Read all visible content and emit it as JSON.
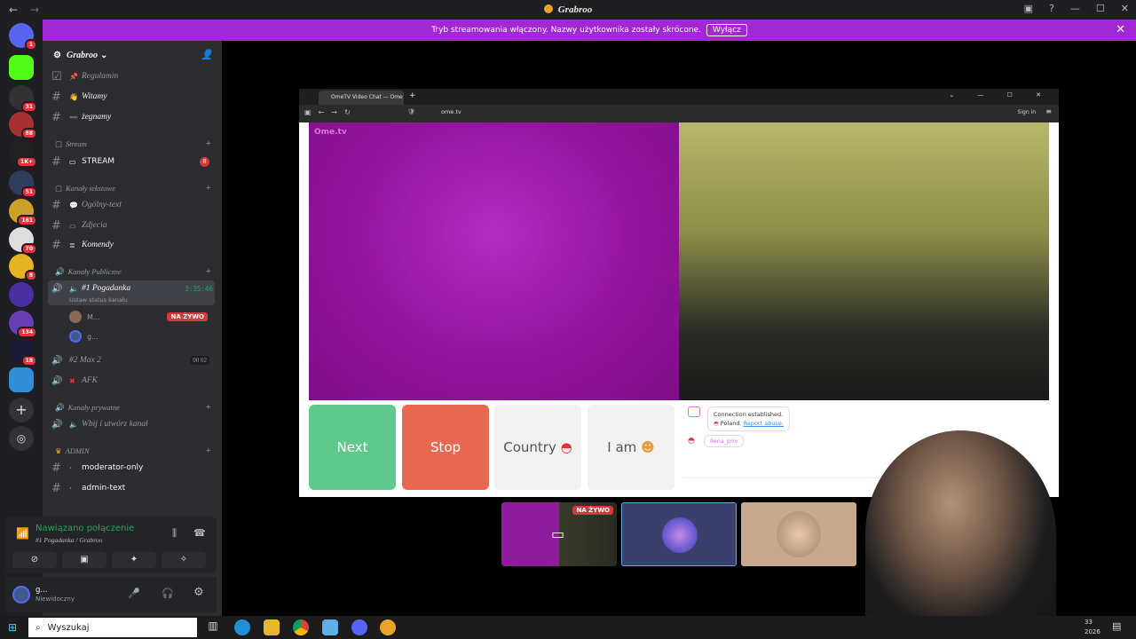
{
  "window": {
    "title": "Grabroo"
  },
  "banner": {
    "text": "Tryb streamowania włączony. Nazwy użytkownika zostały skrócone.",
    "button": "Wyłącz"
  },
  "server_badges": [
    "1",
    "",
    "31",
    "88",
    "1K+",
    "51",
    "161",
    "70",
    "8",
    "",
    "134",
    "18"
  ],
  "server": {
    "name": "Grabroo"
  },
  "channels": {
    "regulamin": "Regulamin",
    "witamy": "Witamy",
    "zegnamy": "żegnamy",
    "cat_stream": "Stream",
    "stream": "STREAM",
    "stream_badge": "8",
    "cat_text": "Kanały tekstowe",
    "ogolny": "Ogólny-text",
    "zdjecia": "Zdjecia",
    "komendy": "Komendy",
    "cat_public": "Kanały Publiczne",
    "pogadanka": "#1 Pogadanka",
    "pogadanka_time": "3:35:46",
    "pogadanka_status": "Ustaw status kanału",
    "user1": "M...",
    "user1_live": "NA ŻYWO",
    "user2": "g...",
    "max2": "#2 Max 2",
    "max2_a": "00",
    "max2_b": "02",
    "afk": "AFK",
    "cat_private": "Kanały prywatne",
    "wbij": "Wbij i utwórz kanał",
    "cat_admin": "ADMIN",
    "moderator": "moderator-only",
    "admintext": "admin-text"
  },
  "voice_panel": {
    "status": "Nawiązano połączenie",
    "channel": "#1 Pogadanka / Grabroo"
  },
  "user_panel": {
    "name": "g...",
    "status": "Niewidoczny"
  },
  "browser": {
    "tab": "OmeTV Video Chat — Ome",
    "url": "ome.tv",
    "signin": "Sign in",
    "logo": "Ome.tv"
  },
  "ometv": {
    "next": "Next",
    "stop": "Stop",
    "country": "Country",
    "iam": "I am",
    "chat_line1": "Connection established.",
    "chat_line2": "Poland.",
    "chat_link": "Report abuse.",
    "chat_user": "ilena_priv"
  },
  "thumb_live": "NA ŻYWO",
  "taskbar": {
    "search": "Wyszukaj",
    "time": "33",
    "date": "2026"
  },
  "colors": {
    "accent": "#a128d4",
    "next": "#5fc98d",
    "stop": "#e8694f",
    "live": "#da373c"
  }
}
